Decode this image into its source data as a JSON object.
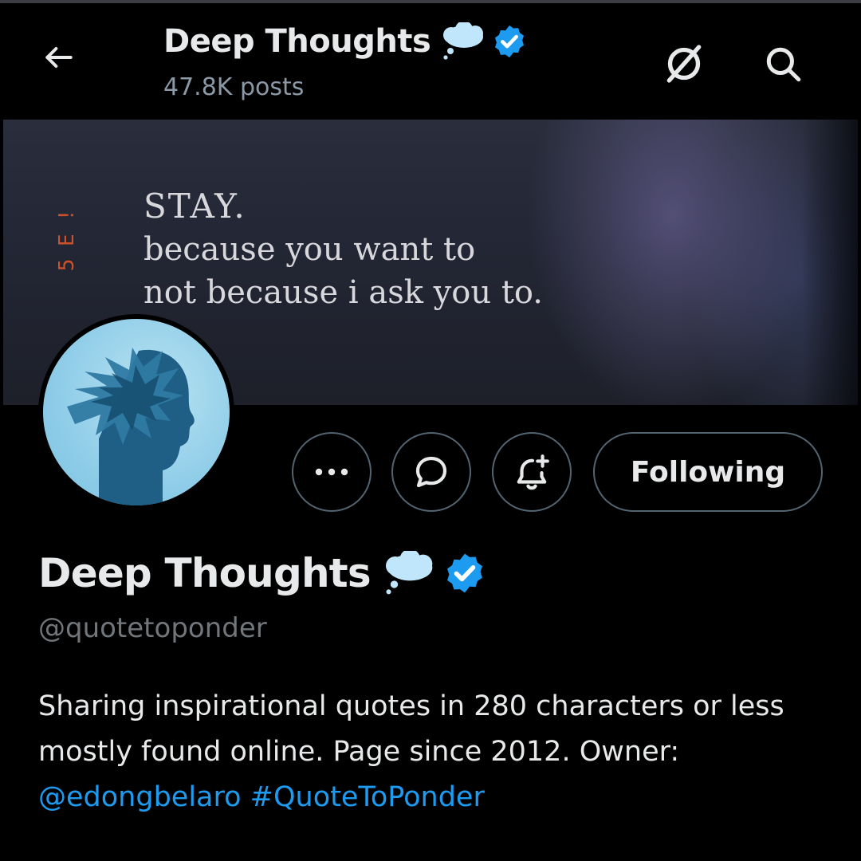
{
  "header": {
    "title": "Deep Thoughts",
    "posts_count": "47.8K posts"
  },
  "banner": {
    "line1": "STAY.",
    "line2": "because you want to",
    "line3": "not because i ask you to.",
    "side_text": "5 E !"
  },
  "actions": {
    "more_icon": "more-horizontal-icon",
    "message_icon": "message-icon",
    "notify_icon": "bell-plus-icon",
    "follow_label": "Following"
  },
  "profile": {
    "name": "Deep Thoughts",
    "handle": "@quotetoponder",
    "bio_text": "Sharing inspirational quotes in 280 characters or less mostly found online. Page since 2012. Owner:",
    "bio_mention": "@edongbelaro",
    "bio_hashtag": "#QuoteToPonder"
  },
  "icons": {
    "back": "back-arrow-icon",
    "grok": "grok-icon",
    "search": "search-icon",
    "emoji": "thought-balloon-emoji",
    "verified": "verified-badge-icon"
  },
  "colors": {
    "accent": "#1d9bf0",
    "background": "#000000",
    "text_primary": "#e7e9ea",
    "text_secondary": "#71767b",
    "button_border": "#536471"
  }
}
